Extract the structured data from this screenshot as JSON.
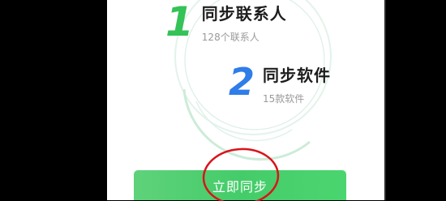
{
  "steps": [
    {
      "number": "1",
      "title": "同步联系人",
      "subtitle": "128个联系人"
    },
    {
      "number": "2",
      "title": "同步软件",
      "subtitle": "15款软件"
    }
  ],
  "sync_button": {
    "label": "立即同步"
  },
  "colors": {
    "accent_green": "#45cc6a",
    "step1_green": "#35c257",
    "step2_blue": "#2e7de8",
    "annotation_red": "#d9141a"
  }
}
